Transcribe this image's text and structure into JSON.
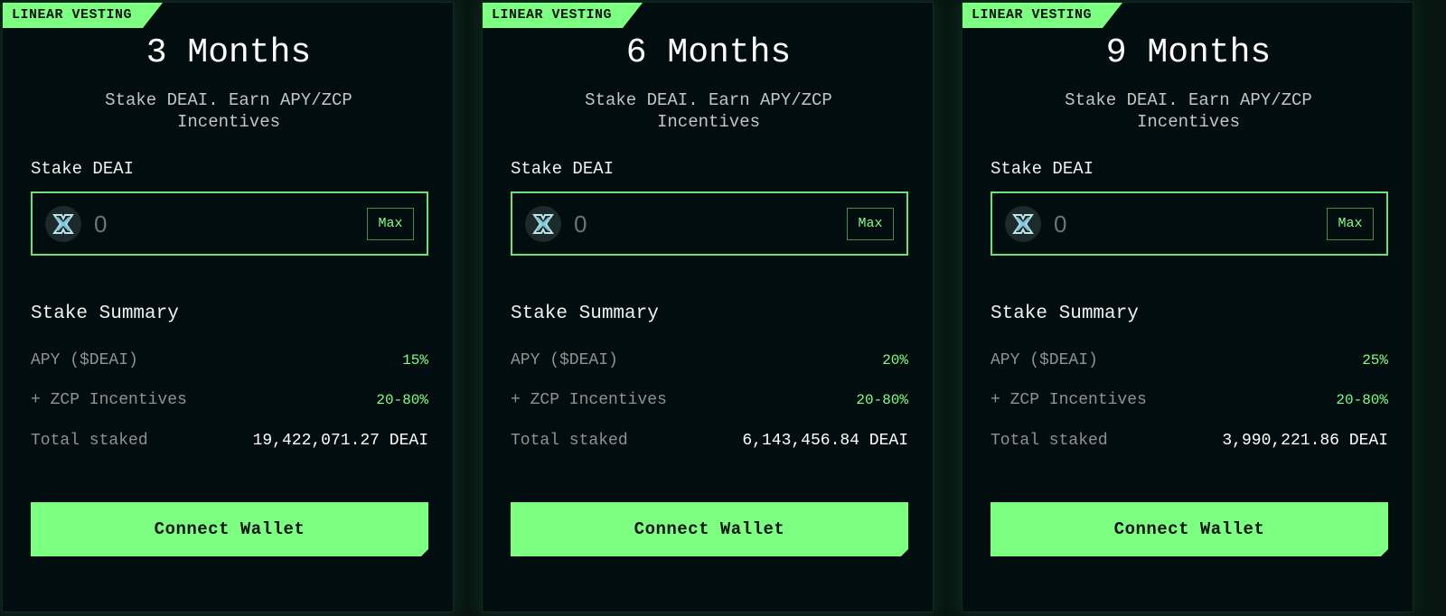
{
  "colors": {
    "accent": "#7dff82",
    "background": "#020d10",
    "text_muted": "#8c9492",
    "text_primary": "#ffffff"
  },
  "cards": [
    {
      "badge": "LINEAR VESTING",
      "title": "3 Months",
      "subtitle": "Stake DEAI. Earn APY/ZCP Incentives",
      "stake_label": "Stake DEAI",
      "input": {
        "value": "",
        "placeholder": "0",
        "token_icon": "deai-token-icon"
      },
      "max_label": "Max",
      "summary_title": "Stake Summary",
      "rows": [
        {
          "label": "APY ($DEAI)",
          "value": "15%"
        },
        {
          "label": "+ ZCP Incentives",
          "value": "20-80%"
        },
        {
          "label": "Total staked",
          "value": "19,422,071.27 DEAI"
        }
      ],
      "button_label": "Connect Wallet"
    },
    {
      "badge": "LINEAR VESTING",
      "title": "6 Months",
      "subtitle": "Stake DEAI. Earn APY/ZCP Incentives",
      "stake_label": "Stake DEAI",
      "input": {
        "value": "",
        "placeholder": "0",
        "token_icon": "deai-token-icon"
      },
      "max_label": "Max",
      "summary_title": "Stake Summary",
      "rows": [
        {
          "label": "APY ($DEAI)",
          "value": "20%"
        },
        {
          "label": "+ ZCP Incentives",
          "value": "20-80%"
        },
        {
          "label": "Total staked",
          "value": "6,143,456.84 DEAI"
        }
      ],
      "button_label": "Connect Wallet"
    },
    {
      "badge": "LINEAR VESTING",
      "title": "9 Months",
      "subtitle": "Stake DEAI. Earn APY/ZCP Incentives",
      "stake_label": "Stake DEAI",
      "input": {
        "value": "",
        "placeholder": "0",
        "token_icon": "deai-token-icon"
      },
      "max_label": "Max",
      "summary_title": "Stake Summary",
      "rows": [
        {
          "label": "APY ($DEAI)",
          "value": "25%"
        },
        {
          "label": "+ ZCP Incentives",
          "value": "20-80%"
        },
        {
          "label": "Total staked",
          "value": "3,990,221.86 DEAI"
        }
      ],
      "button_label": "Connect Wallet"
    }
  ]
}
